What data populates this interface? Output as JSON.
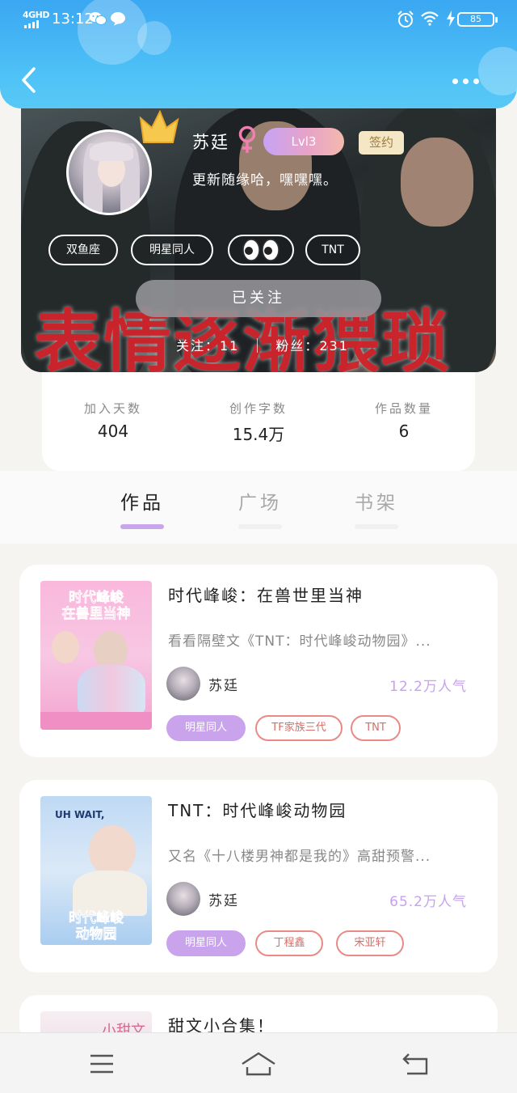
{
  "status_bar": {
    "network": "4GHD",
    "time": "13:12",
    "battery": "85"
  },
  "profile": {
    "name": "苏廷",
    "gender_symbol": "♀",
    "level": "Lvl3",
    "sign_badge": "签约",
    "bio": "更新随缘哈，嘿嘿嘿。",
    "tags": [
      "双鱼座",
      "明星同人",
      "",
      "TNT"
    ],
    "follow_button": "已关注",
    "following": "关注：11",
    "followers": "粉丝：231",
    "banner_text": "表情逐渐猥琐"
  },
  "stats": [
    {
      "label": "加入天数",
      "value": "404"
    },
    {
      "label": "创作字数",
      "value": "15.4万"
    },
    {
      "label": "作品数量",
      "value": "6"
    }
  ],
  "tabs": [
    {
      "label": "作品",
      "active": true
    },
    {
      "label": "广场",
      "active": false
    },
    {
      "label": "书架",
      "active": false
    }
  ],
  "works": [
    {
      "title": "时代峰峻：在兽世里当神",
      "desc": "看看隔壁文《TNT：时代峰峻动物园》...",
      "author": "苏廷",
      "popularity": "12.2万人气",
      "tags": [
        "明星同人",
        "TF家族三代",
        "TNT"
      ],
      "cover_text": [
        "时代峰峻",
        "在兽里当神"
      ]
    },
    {
      "title": "TNT：时代峰峻动物园",
      "desc": "又名《十八楼男神都是我的》高甜预警...",
      "author": "苏廷",
      "popularity": "65.2万人气",
      "tags": [
        "明星同人",
        "丁程鑫",
        "宋亚轩"
      ],
      "cover_text": [
        "UH WAIT,",
        "时代峰峻",
        "动物园"
      ]
    },
    {
      "title": "甜文小合集！",
      "cover_text": [
        "小甜文"
      ]
    }
  ],
  "colors": {
    "header_blue": "#3aa7f2",
    "accent_purple": "#c9a3ec",
    "tag_red": "#e98a86",
    "banner_red_text": "#d8242c"
  },
  "icons": {
    "back": "back-arrow-icon",
    "more": "more-dots-icon",
    "nav_menu": "menu-lines-icon",
    "nav_home": "home-icon",
    "nav_back": "return-icon"
  }
}
